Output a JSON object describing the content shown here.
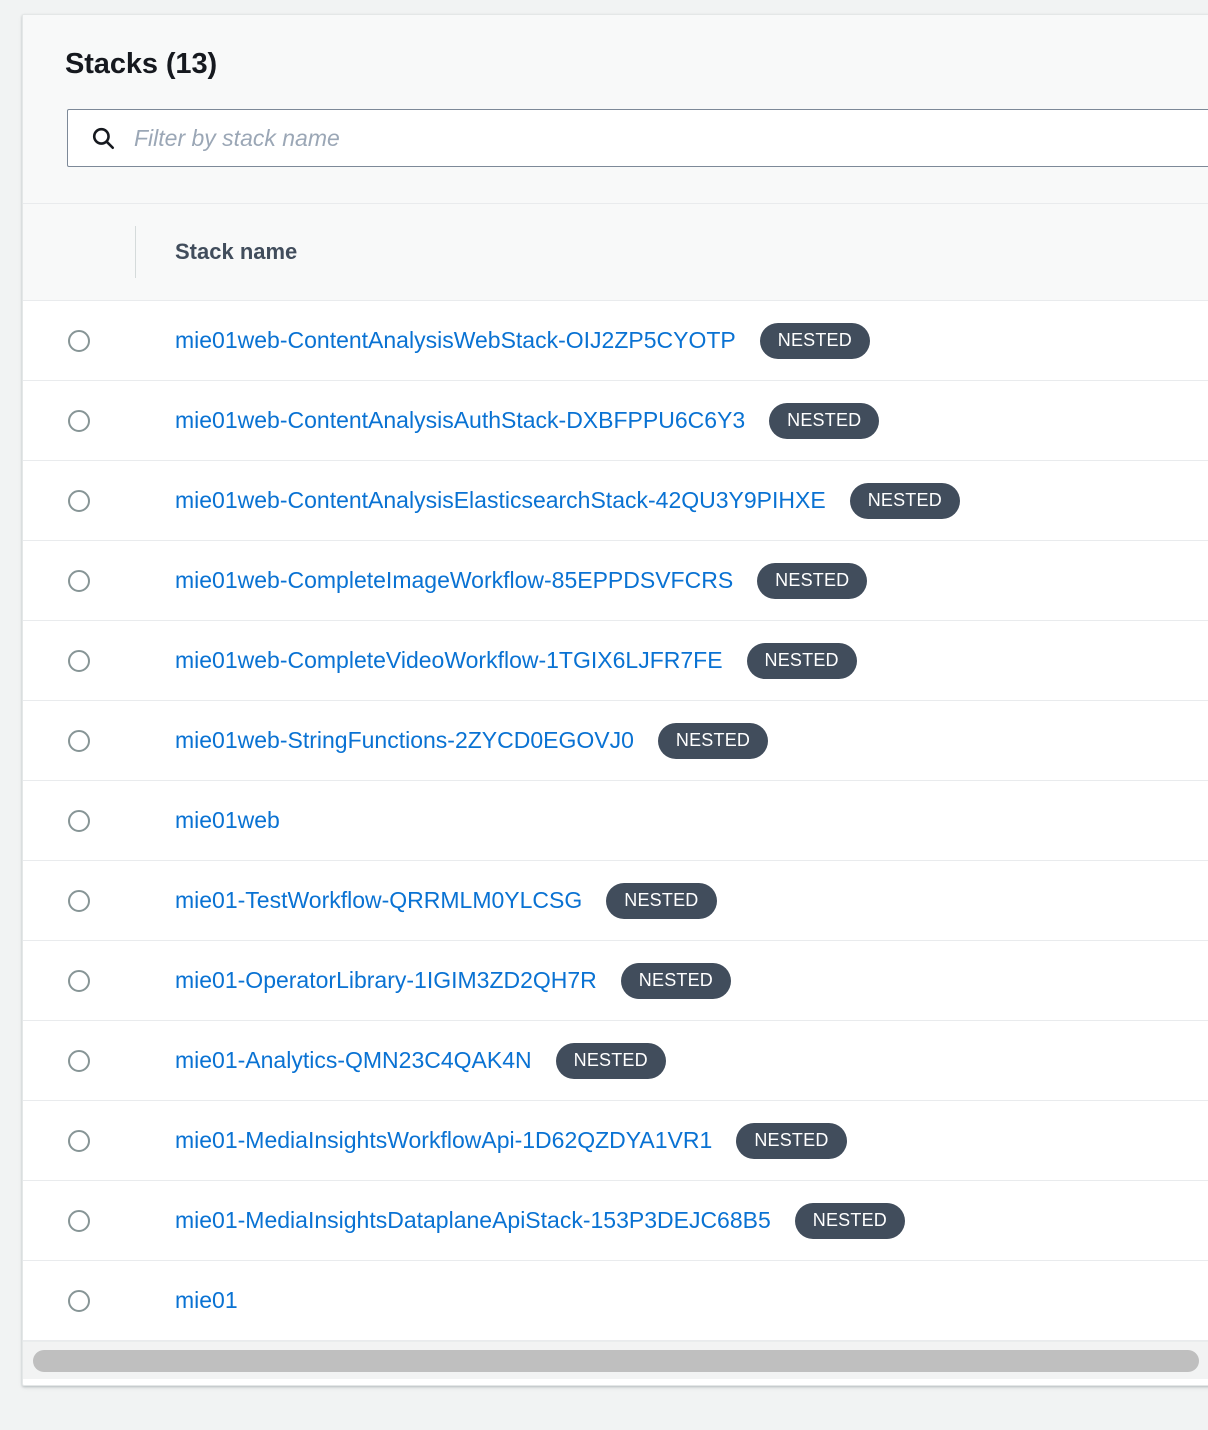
{
  "panel": {
    "title": "Stacks (13)"
  },
  "search": {
    "placeholder": "Filter by stack name",
    "value": "",
    "icon": "search-icon"
  },
  "table": {
    "columns": [
      "Stack name"
    ],
    "nested_badge_label": "NESTED",
    "rows": [
      {
        "name": "mie01web-ContentAnalysisWebStack-OIJ2ZP5CYOTP",
        "nested": true
      },
      {
        "name": "mie01web-ContentAnalysisAuthStack-DXBFPPU6C6Y3",
        "nested": true
      },
      {
        "name": "mie01web-ContentAnalysisElasticsearchStack-42QU3Y9PIHXE",
        "nested": true
      },
      {
        "name": "mie01web-CompleteImageWorkflow-85EPPDSVFCRS",
        "nested": true
      },
      {
        "name": "mie01web-CompleteVideoWorkflow-1TGIX6LJFR7FE",
        "nested": true
      },
      {
        "name": "mie01web-StringFunctions-2ZYCD0EGOVJ0",
        "nested": true
      },
      {
        "name": "mie01web",
        "nested": false
      },
      {
        "name": "mie01-TestWorkflow-QRRMLM0YLCSG",
        "nested": true
      },
      {
        "name": "mie01-OperatorLibrary-1IGIM3ZD2QH7R",
        "nested": true
      },
      {
        "name": "mie01-Analytics-QMN23C4QAK4N",
        "nested": true
      },
      {
        "name": "mie01-MediaInsightsWorkflowApi-1D62QZDYA1VR1",
        "nested": true
      },
      {
        "name": "mie01-MediaInsightsDataplaneApiStack-153P3DEJC68B5",
        "nested": true
      },
      {
        "name": "mie01",
        "nested": false
      }
    ]
  },
  "colors": {
    "link": "#0972d3",
    "badge_bg": "#414d5c",
    "badge_text": "#ffffff",
    "page_bg": "#f1f3f3",
    "header_bg": "#f8f9f9"
  }
}
